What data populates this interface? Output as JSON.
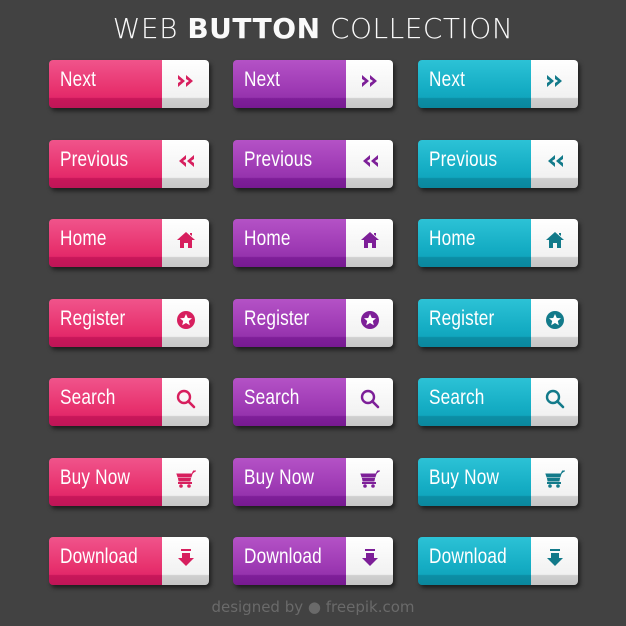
{
  "title": {
    "regular_1": "WEB ",
    "bold": "BUTTON",
    "regular_2": " COLLECTION"
  },
  "themes": [
    {
      "name": "pink",
      "color": "#e8336f",
      "icon_color": "#d71f5e"
    },
    {
      "name": "purple",
      "color": "#9e3ab4",
      "icon_color": "#7d1f98"
    },
    {
      "name": "cyan",
      "color": "#15adc4",
      "icon_color": "#127a8a"
    }
  ],
  "buttons": [
    {
      "label": "Next",
      "icon": "double-chevron-right-icon"
    },
    {
      "label": "Previous",
      "icon": "double-chevron-left-icon"
    },
    {
      "label": "Home",
      "icon": "home-icon"
    },
    {
      "label": "Register",
      "icon": "star-circle-icon"
    },
    {
      "label": "Search",
      "icon": "search-icon"
    },
    {
      "label": "Buy Now",
      "icon": "cart-icon"
    },
    {
      "label": "Download",
      "icon": "download-arrow-icon"
    }
  ],
  "credit": {
    "prefix": "designed by",
    "brand": "freepik.com"
  }
}
